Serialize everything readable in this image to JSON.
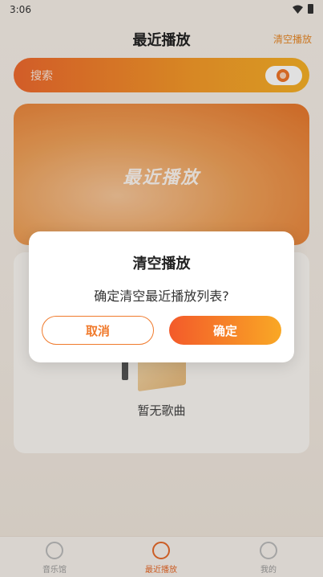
{
  "status_bar": {
    "time": "3:06"
  },
  "header": {
    "title": "最近播放",
    "clear_label": "清空播放"
  },
  "search": {
    "placeholder": "搜索"
  },
  "banner": {
    "title": "最近播放"
  },
  "empty_state": {
    "text": "暂无歌曲"
  },
  "bottom_nav": {
    "items": [
      {
        "label": "音乐馆",
        "active": false
      },
      {
        "label": "最近播放",
        "active": true
      },
      {
        "label": "我的",
        "active": false
      }
    ]
  },
  "dialog": {
    "title": "清空播放",
    "message": "确定清空最近播放列表?",
    "cancel_label": "取消",
    "confirm_label": "确定"
  },
  "colors": {
    "accent": "#f07a2c",
    "gradient_start": "#f35a2a",
    "gradient_end": "#f9a825"
  }
}
